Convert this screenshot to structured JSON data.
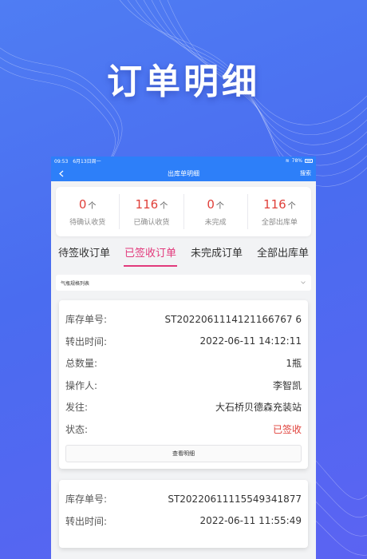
{
  "promo": {
    "title": "订单明细"
  },
  "statusbar": {
    "time": "09:53",
    "date": "6月13日周一",
    "battery": "78%"
  },
  "nav": {
    "title": "出库单明细",
    "search": "搜索"
  },
  "stats": [
    {
      "value": "0",
      "unit": "个",
      "label": "待确认收货"
    },
    {
      "value": "116",
      "unit": "个",
      "label": "已确认收货"
    },
    {
      "value": "0",
      "unit": "个",
      "label": "未完成"
    },
    {
      "value": "116",
      "unit": "个",
      "label": "全部出库单"
    }
  ],
  "tabs": [
    {
      "label": "待签收订单",
      "active": false
    },
    {
      "label": "已签收订单",
      "active": true
    },
    {
      "label": "未完成订单",
      "active": false
    },
    {
      "label": "全部出库单",
      "active": false
    }
  ],
  "dropdown": {
    "value": "气瓶规格列表"
  },
  "orders": [
    {
      "rows": [
        {
          "key": "库存单号:",
          "value": "ST2022061114121166767 6"
        },
        {
          "key": "转出时间:",
          "value": "2022-06-11 14:12:11"
        },
        {
          "key": "总数量:",
          "value": "1瓶"
        },
        {
          "key": "操作人:",
          "value": "李智凯"
        },
        {
          "key": "发往:",
          "value": "大石桥贝德森充装站"
        },
        {
          "key": "状态:",
          "value": "已签收"
        }
      ],
      "button": "查看明细"
    },
    {
      "rows": [
        {
          "key": "库存单号:",
          "value": "ST20220611115549341877"
        },
        {
          "key": "转出时间:",
          "value": "2022-06-11 11:55:49"
        }
      ]
    }
  ],
  "colors": {
    "accent_blue": "#2d7ff9",
    "tab_active": "#e23a7c",
    "stat_red": "#e0403a"
  }
}
